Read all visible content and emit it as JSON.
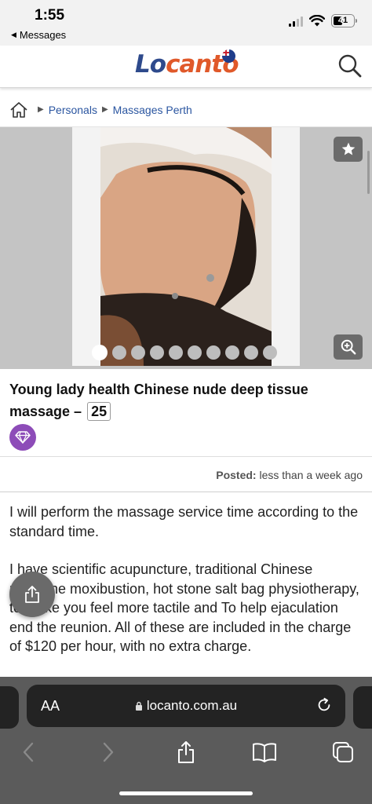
{
  "status_bar": {
    "time": "1:55",
    "back_label": "Messages",
    "battery": "41"
  },
  "header": {
    "logo_part1": "Lo",
    "logo_part2": "canto",
    "search_icon": "search-icon"
  },
  "breadcrumb": {
    "home_icon": "home-icon",
    "items": [
      "Personals",
      "Massages Perth"
    ]
  },
  "gallery": {
    "photo_count": 10,
    "active_index": 0,
    "favorite_icon": "star-icon",
    "zoom_icon": "zoom-in-icon"
  },
  "listing": {
    "title": "Young lady health Chinese nude deep tissue massage –",
    "age": "25",
    "badge_icon": "diamond-icon",
    "posted_label": "Posted:",
    "posted_value": "less than a week ago",
    "description": [
      "I will perform the massage service time according to the standard time.",
      "I have scientific acupuncture, traditional Chinese medicine moxibustion, hot stone salt bag physiotherapy, to make you feel more tactile and To help ejaculation end the reunion. All of these are included in the charge of $120 per hour, with no extra charge."
    ]
  },
  "browser": {
    "aa_label": "AA",
    "url": "locanto.com.au"
  },
  "colors": {
    "link": "#2a55a0",
    "logo_blue": "#2e4a8c",
    "logo_orange": "#e0592a",
    "premium": "#8d4cb8"
  }
}
